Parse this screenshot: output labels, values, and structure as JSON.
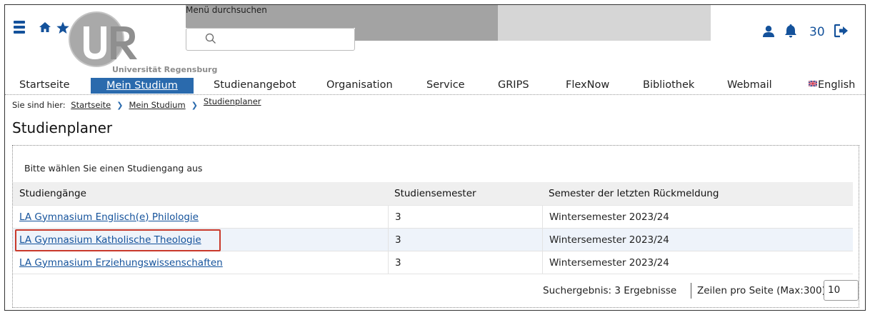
{
  "header": {
    "logo_letters": "UR",
    "logo_caption": "Universität Regensburg",
    "search": {
      "label": "Menü durchsuchen",
      "value": "",
      "placeholder": ""
    },
    "notification_count": "30",
    "icons": [
      "menu-icon",
      "home-icon",
      "star-icon",
      "search-icon",
      "user-icon",
      "bell-icon",
      "logout-icon"
    ]
  },
  "nav": {
    "items": [
      {
        "label": "Startseite"
      },
      {
        "label": "Mein Studium",
        "active": true
      },
      {
        "label": "Studienangebot"
      },
      {
        "label": "Organisation"
      },
      {
        "label": "Service"
      },
      {
        "label": "GRIPS"
      },
      {
        "label": "FlexNow"
      },
      {
        "label": "Bibliothek"
      },
      {
        "label": "Webmail"
      },
      {
        "label": "English"
      }
    ]
  },
  "breadcrumb": {
    "prefix": "Sie sind hier:",
    "items": [
      "Startseite",
      "Mein Studium",
      "Studienplaner"
    ]
  },
  "page": {
    "title": "Studienplaner",
    "prompt": "Bitte wählen Sie einen Studiengang aus"
  },
  "table": {
    "headers": [
      "Studiengänge",
      "Studiensemester",
      "Semester der letzten Rückmeldung"
    ],
    "rows": [
      {
        "program": "LA Gymnasium Englisch(e) Philologie",
        "semester": "3",
        "last_registration": "Wintersemester 2023/24"
      },
      {
        "program": "LA Gymnasium Katholische Theologie",
        "semester": "3",
        "last_registration": "Wintersemester 2023/24"
      },
      {
        "program": "LA Gymnasium Erziehungswissenschaften",
        "semester": "3",
        "last_registration": "Wintersemester 2023/24"
      }
    ]
  },
  "footer": {
    "results": "Suchergebnis: 3 Ergebnisse",
    "rows_per_page_label": "Zeilen pro Seite (Max:300)",
    "rows_per_page_value": "10"
  },
  "colors": {
    "brand_blue": "#14529b",
    "active_nav": "#2a6aad",
    "highlight_border": "#c9392b"
  }
}
